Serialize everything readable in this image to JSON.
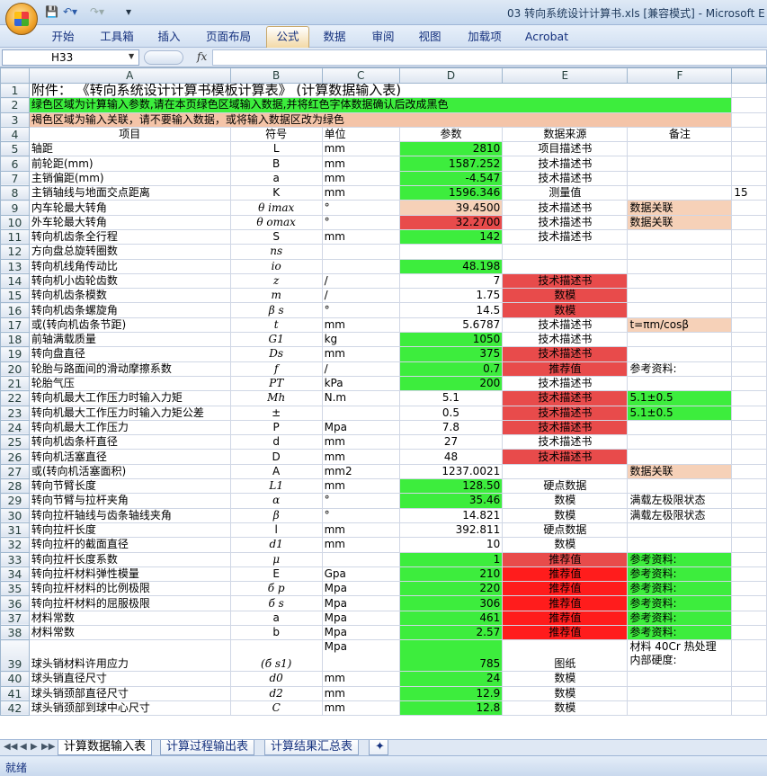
{
  "window": {
    "title": "03 转向系统设计计算书.xls  [兼容模式] - Microsoft E"
  },
  "ribbon": {
    "tabs": [
      "开始",
      "工具箱",
      "插入",
      "页面布局",
      "公式",
      "数据",
      "审阅",
      "视图",
      "加载项",
      "Acrobat"
    ],
    "active_tab": "公式"
  },
  "formula_bar": {
    "name_box": "H33",
    "fx": "fx",
    "formula": ""
  },
  "columns": [
    "A",
    "B",
    "C",
    "D",
    "E",
    "F"
  ],
  "rows": [
    {
      "n": "1",
      "a": "附件：        《转向系统设计计算书模板计算表》 (计算数据输入表)",
      "b": "",
      "c": "",
      "d": "",
      "e": "",
      "f": ""
    },
    {
      "n": "2",
      "a": "绿色区域为计算输入参数,请在本页绿色区域输入数据,并将红色字体数据确认后改成黑色",
      "b": "",
      "c": "",
      "d": "",
      "e": "",
      "f": ""
    },
    {
      "n": "3",
      "a": "褐色区域为输入关联，请不要输入数据，或将输入数据区改为绿色",
      "b": "",
      "c": "",
      "d": "",
      "e": "",
      "f": ""
    },
    {
      "n": "4",
      "a": "项目",
      "b": "符号",
      "c": "单位",
      "d": "参数",
      "e": "数据来源",
      "f": "备注"
    },
    {
      "n": "5",
      "a": "轴距",
      "b": "L",
      "c": "mm",
      "d": "2810",
      "e": "项目描述书",
      "f": ""
    },
    {
      "n": "6",
      "a": "前轮距(mm)",
      "b": "B",
      "c": "mm",
      "d": "1587.252",
      "e": "技术描述书",
      "f": ""
    },
    {
      "n": "7",
      "a": "主销偏距(mm)",
      "b": "a",
      "c": "mm",
      "d": "-4.547",
      "e": "技术描述书",
      "f": ""
    },
    {
      "n": "8",
      "a": "主销轴线与地面交点距离",
      "b": "K",
      "c": "mm",
      "d": "1596.346",
      "e": "测量值",
      "f": "",
      "g": "15"
    },
    {
      "n": "9",
      "a": "内车轮最大转角",
      "b": "θ imax",
      "c": "°",
      "d": "39.4500",
      "e": "技术描述书",
      "f": "数据关联"
    },
    {
      "n": "10",
      "a": "外车轮最大转角",
      "b": "θ omax",
      "c": "°",
      "d": "32.2700",
      "e": "技术描述书",
      "f": "数据关联"
    },
    {
      "n": "11",
      "a": "转向机齿条全行程",
      "b": "S",
      "c": "mm",
      "d": "142",
      "e": "技术描述书",
      "f": ""
    },
    {
      "n": "12",
      "a": "方向盘总旋转圈数",
      "b": "ns",
      "c": "",
      "d": "",
      "e": "",
      "f": ""
    },
    {
      "n": "13",
      "a": "转向机线角传动比",
      "b": "io",
      "c": "",
      "d": "48.198",
      "e": "",
      "f": ""
    },
    {
      "n": "14",
      "a": "转向机小齿轮齿数",
      "b": "z",
      "c": "/",
      "d": "7",
      "e": "技术描述书",
      "f": ""
    },
    {
      "n": "15",
      "a": "转向机齿条模数",
      "b": "m",
      "c": "/",
      "d": "1.75",
      "e": "数模",
      "f": ""
    },
    {
      "n": "16",
      "a": "转向机齿条螺旋角",
      "b": "β s",
      "c": "°",
      "d": "14.5",
      "e": "数模",
      "f": ""
    },
    {
      "n": "17",
      "a": "或(转向机齿条节距)",
      "b": "t",
      "c": "mm",
      "d": "5.6787",
      "e": "技术描述书",
      "f": "t=πm/cosβ"
    },
    {
      "n": "18",
      "a": "前轴满载质量",
      "b": "G1",
      "c": "kg",
      "d": "1050",
      "e": "技术描述书",
      "f": ""
    },
    {
      "n": "19",
      "a": "转向盘直径",
      "b": "Ds",
      "c": "mm",
      "d": "375",
      "e": "技术描述书",
      "f": ""
    },
    {
      "n": "20",
      "a": "轮胎与路面间的滑动摩擦系数",
      "b": "f",
      "c": "/",
      "d": "0.7",
      "e": "推荐值",
      "f": "参考资料:"
    },
    {
      "n": "21",
      "a": "轮胎气压",
      "b": "PT",
      "c": "kPa",
      "d": "200",
      "e": "技术描述书",
      "f": ""
    },
    {
      "n": "22",
      "a": "转向机最大工作压力时输入力矩",
      "b": "Mh",
      "c": "N.m",
      "d": "5.1",
      "e": "技术描述书",
      "f": "5.1±0.5"
    },
    {
      "n": "23",
      "a": "转向机最大工作压力时输入力矩公差",
      "b": "±",
      "c": "",
      "d": "0.5",
      "e": "技术描述书",
      "f": "5.1±0.5"
    },
    {
      "n": "24",
      "a": "转向机最大工作压力",
      "b": "P",
      "c": "Mpa",
      "d": "7.8",
      "e": "技术描述书",
      "f": ""
    },
    {
      "n": "25",
      "a": "转向机齿条杆直径",
      "b": "d",
      "c": "mm",
      "d": "27",
      "e": "技术描述书",
      "f": ""
    },
    {
      "n": "26",
      "a": "转向机活塞直径",
      "b": "D",
      "c": "mm",
      "d": "48",
      "e": "技术描述书",
      "f": ""
    },
    {
      "n": "27",
      "a": "或(转向机活塞面积)",
      "b": "A",
      "c": "mm2",
      "d": "1237.0021",
      "e": "",
      "f": "数据关联"
    },
    {
      "n": "28",
      "a": "转向节臂长度",
      "b": "L1",
      "c": "mm",
      "d": "128.50",
      "e": "硬点数据",
      "f": ""
    },
    {
      "n": "29",
      "a": "转向节臂与拉杆夹角",
      "b": "α",
      "c": "°",
      "d": "35.46",
      "e": "数模",
      "f": "满载左极限状态"
    },
    {
      "n": "30",
      "a": "转向拉杆轴线与齿条轴线夹角",
      "b": "β",
      "c": "°",
      "d": "14.821",
      "e": "数模",
      "f": "满载左极限状态"
    },
    {
      "n": "31",
      "a": "转向拉杆长度",
      "b": "l",
      "c": "mm",
      "d": "392.811",
      "e": "硬点数据",
      "f": ""
    },
    {
      "n": "32",
      "a": "转向拉杆的截面直径",
      "b": "d1",
      "c": "mm",
      "d": "10",
      "e": "数模",
      "f": ""
    },
    {
      "n": "33",
      "a": "转向拉杆长度系数",
      "b": "μ",
      "c": "",
      "d": "1",
      "e": "推荐值",
      "f": "参考资料:"
    },
    {
      "n": "34",
      "a": "转向拉杆材料弹性模量",
      "b": "E",
      "c": "Gpa",
      "d": "210",
      "e": "推荐值",
      "f": "参考资料:"
    },
    {
      "n": "35",
      "a": "转向拉杆材料的比例极限",
      "b": "б p",
      "c": "Mpa",
      "d": "220",
      "e": "推荐值",
      "f": "参考资料:"
    },
    {
      "n": "36",
      "a": "转向拉杆材料的屈服极限",
      "b": "б s",
      "c": "Mpa",
      "d": "306",
      "e": "推荐值",
      "f": "参考资料:"
    },
    {
      "n": "37",
      "a": "材料常数",
      "b": "a",
      "c": "Mpa",
      "d": "461",
      "e": "推荐值",
      "f": "参考资料:"
    },
    {
      "n": "38",
      "a": "材料常数",
      "b": "b",
      "c": "Mpa",
      "d": "2.57",
      "e": "推荐值",
      "f": "参考资料:"
    },
    {
      "n": "39",
      "a": "球头销材料许用应力",
      "b": "(б s1)",
      "c": "Mpa",
      "d": "785",
      "e": "图纸",
      "f": "材料 40Cr 热处理",
      "f2": "内部硬度:"
    },
    {
      "n": "40",
      "a": "球头销直径尺寸",
      "b": "d0",
      "c": "mm",
      "d": "24",
      "e": "数模",
      "f": ""
    },
    {
      "n": "41",
      "a": "球头销颈部直径尺寸",
      "b": "d2",
      "c": "mm",
      "d": "12.9",
      "e": "数模",
      "f": ""
    },
    {
      "n": "42",
      "a": "球头销颈部到球中心尺寸",
      "b": "C",
      "c": "mm",
      "d": "12.8",
      "e": "数模",
      "f": ""
    }
  ],
  "sheet_tabs": [
    "计算数据输入表",
    "计算过程输出表",
    "计算结果汇总表"
  ],
  "active_sheet": "计算数据输入表",
  "status": "就绪"
}
